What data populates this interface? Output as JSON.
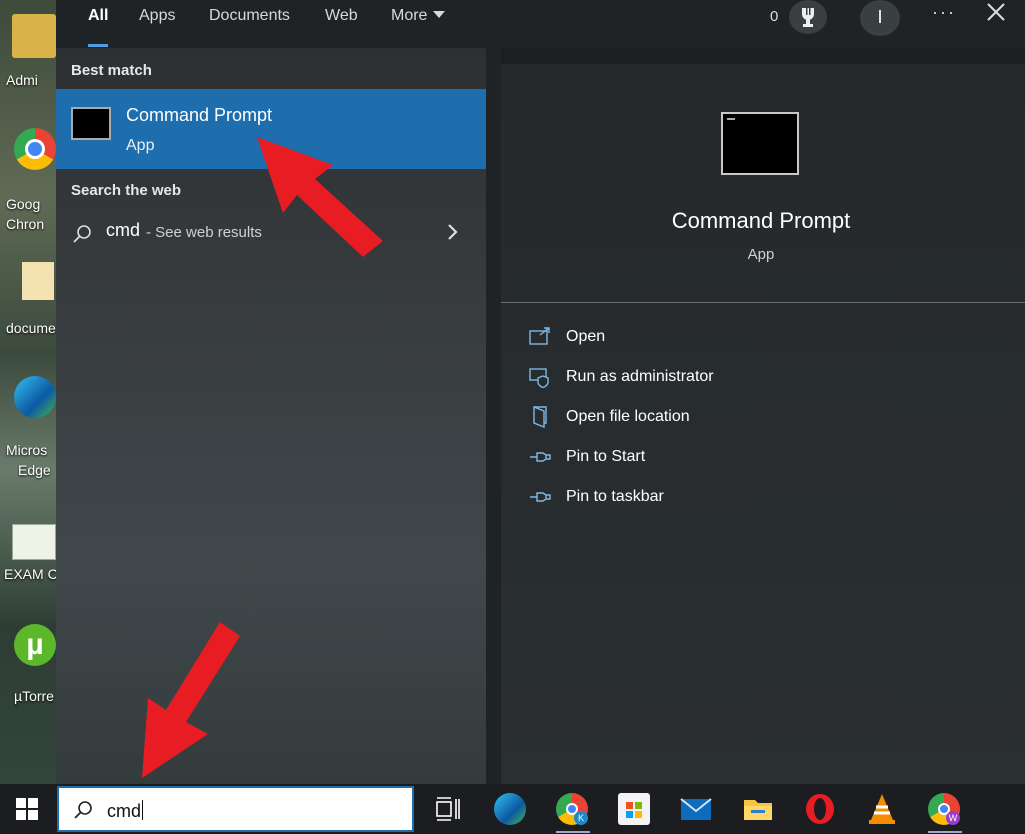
{
  "desktop": {
    "icons": [
      {
        "label": "Admi"
      },
      {
        "label": "Goog"
      },
      {
        "label": "Chron"
      },
      {
        "label": "docume"
      },
      {
        "label": "Micros"
      },
      {
        "label": "Edge"
      },
      {
        "label": "EXAM C"
      },
      {
        "label": "µTorre"
      }
    ]
  },
  "topbar": {
    "tabs": [
      {
        "label": "All",
        "active": true
      },
      {
        "label": "Apps"
      },
      {
        "label": "Documents"
      },
      {
        "label": "Web"
      },
      {
        "label": "More"
      }
    ],
    "reward_points": "0",
    "avatar_initial": "I",
    "more_options": "···"
  },
  "results": {
    "best_match_heading": "Best match",
    "best_match": {
      "title": "Command Prompt",
      "type": "App"
    },
    "web_heading": "Search the web",
    "web_query": "cmd",
    "web_hint": " - See web results"
  },
  "details": {
    "title": "Command Prompt",
    "type": "App",
    "actions": [
      {
        "label": "Open",
        "icon": "open-icon"
      },
      {
        "label": "Run as administrator",
        "icon": "shield-icon"
      },
      {
        "label": "Open file location",
        "icon": "file-location-icon"
      },
      {
        "label": "Pin to Start",
        "icon": "pin-icon"
      },
      {
        "label": "Pin to taskbar",
        "icon": "pin-icon"
      }
    ]
  },
  "taskbar": {
    "search_value": "cmd",
    "apps": [
      "task-view",
      "edge",
      "chrome",
      "store",
      "mail",
      "file-explorer",
      "opera",
      "vlc",
      "chrome-profile"
    ]
  },
  "colors": {
    "accent": "#1e6dad",
    "panel": "#1f2326",
    "arrow": "#e81c23"
  }
}
